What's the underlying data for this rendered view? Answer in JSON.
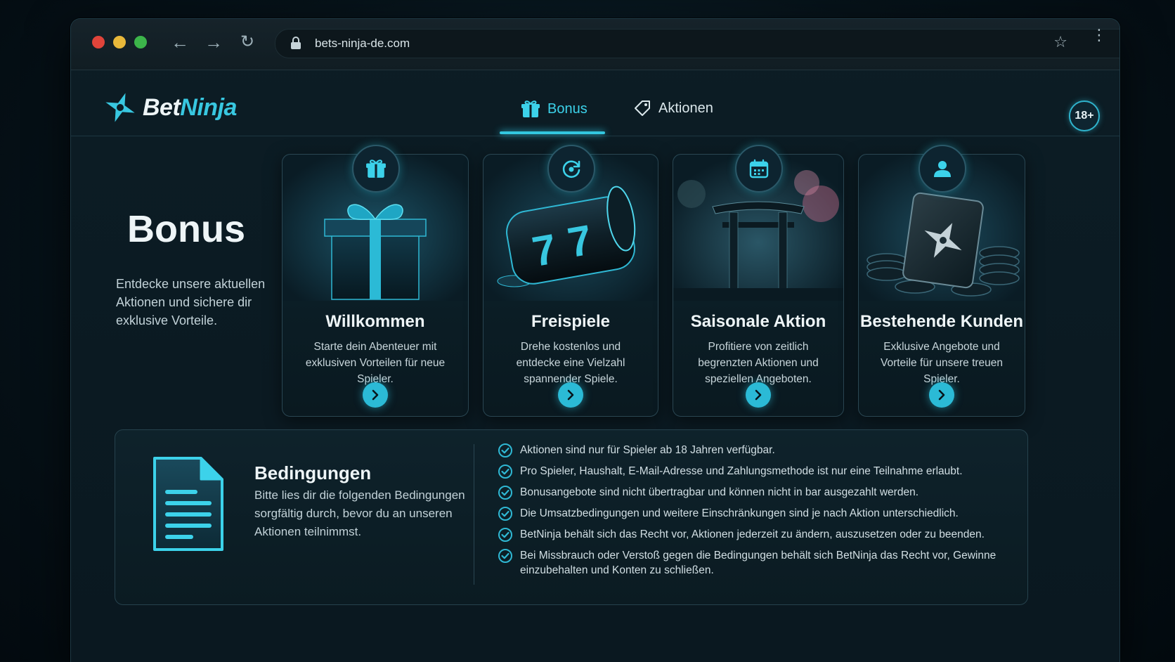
{
  "browser": {
    "url": "bets-ninja-de.com"
  },
  "brand": {
    "name_part1": "Bet",
    "name_part2": "Ninja",
    "accent_color": "#38c7e0"
  },
  "nav": {
    "tabs": [
      {
        "label": "Bonus",
        "icon": "gift-icon",
        "active": true
      },
      {
        "label": "Aktionen",
        "icon": "tag-icon",
        "active": false
      }
    ],
    "age_badge": "18+"
  },
  "hero": {
    "title": "Bonus",
    "subtitle": "Entdecke unsere aktuellen Aktionen und sichere dir exklusive Vorteile."
  },
  "cards": [
    {
      "title": "Willkommen",
      "desc": "Starte dein Abenteuer mit exklusiven Vorteilen für neue Spieler.",
      "icon": "gift-icon"
    },
    {
      "title": "Freispiele",
      "desc": "Drehe kostenlos und entdecke eine Vielzahl spannender Spiele.",
      "icon": "spin-icon"
    },
    {
      "title": "Saisonale Aktion",
      "desc": "Profitiere von zeitlich begrenzten Aktionen und speziellen Angeboten.",
      "icon": "calendar-icon"
    },
    {
      "title": "Bestehende Kunden",
      "desc": "Exklusive Angebote und Vorteile für unsere treuen Spieler.",
      "icon": "user-icon"
    }
  ],
  "conditions": {
    "title": "Bedingungen",
    "subtitle": "Bitte lies dir die folgenden Bedingungen sorgfältig durch, bevor du an unseren Aktionen teilnimmst.",
    "items": [
      "Aktionen sind nur für Spieler ab 18 Jahren verfügbar.",
      "Pro Spieler, Haushalt, E-Mail-Adresse und Zahlungsmethode ist nur eine Teilnahme erlaubt.",
      "Bonusangebote sind nicht übertragbar und können nicht in bar ausgezahlt werden.",
      "Die Umsatzbedingungen und weitere Einschränkungen sind je nach Aktion unterschiedlich.",
      "BetNinja behält sich das Recht vor, Aktionen jederzeit zu ändern, auszusetzen oder zu beenden.",
      "Bei Missbrauch oder Verstoß gegen die Bedingungen behält sich BetNinja das Recht vor, Gewinne einzubehalten und Konten zu schließen."
    ]
  }
}
